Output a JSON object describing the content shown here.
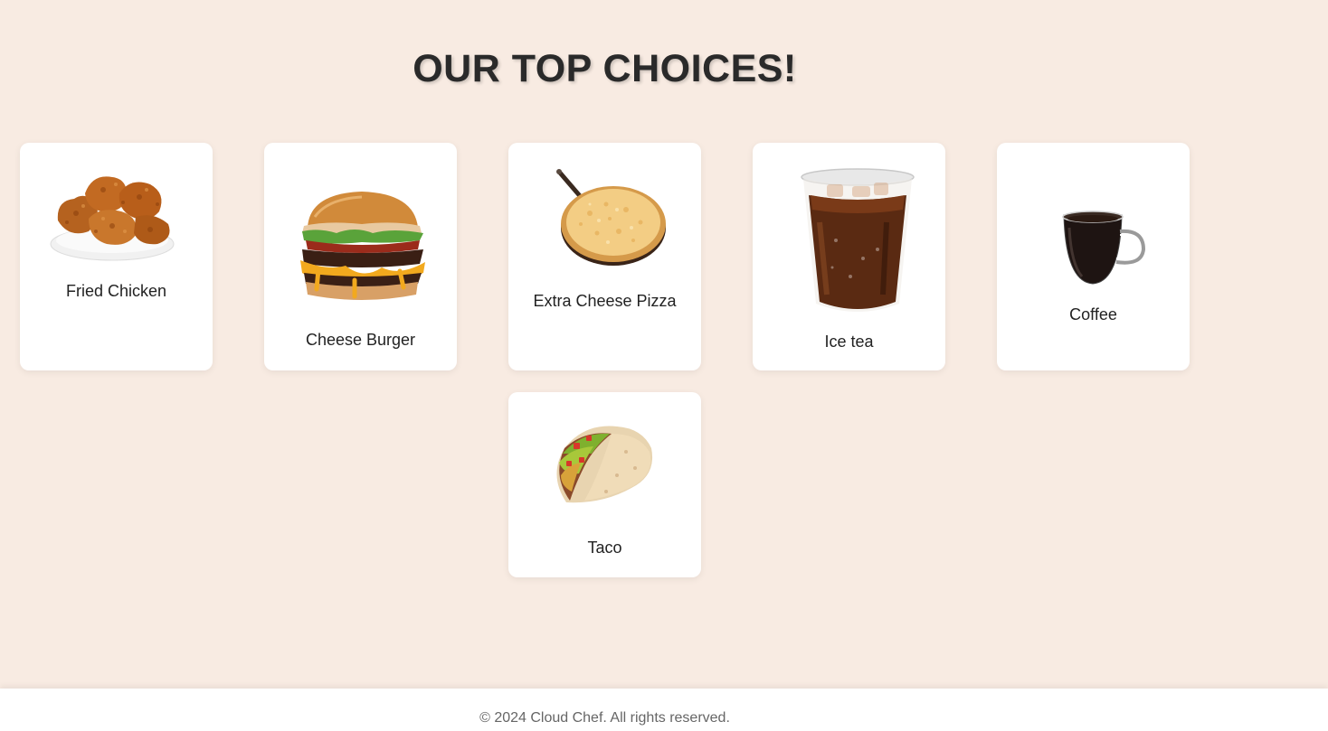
{
  "page": {
    "title": "OUR TOP CHOICES!"
  },
  "items": [
    {
      "name": "Fried Chicken",
      "icon": "fried-chicken-image"
    },
    {
      "name": "Cheese Burger",
      "icon": "cheese-burger-image"
    },
    {
      "name": "Extra Cheese Pizza",
      "icon": "pizza-image"
    },
    {
      "name": "Ice tea",
      "icon": "ice-tea-image"
    },
    {
      "name": "Coffee",
      "icon": "coffee-image"
    },
    {
      "name": "Taco",
      "icon": "taco-image"
    }
  ],
  "footer": {
    "text": "© 2024 Cloud Chef. All rights reserved."
  },
  "colors": {
    "background": "#f8ebe2",
    "card": "#ffffff",
    "title": "#2a2a2a"
  }
}
